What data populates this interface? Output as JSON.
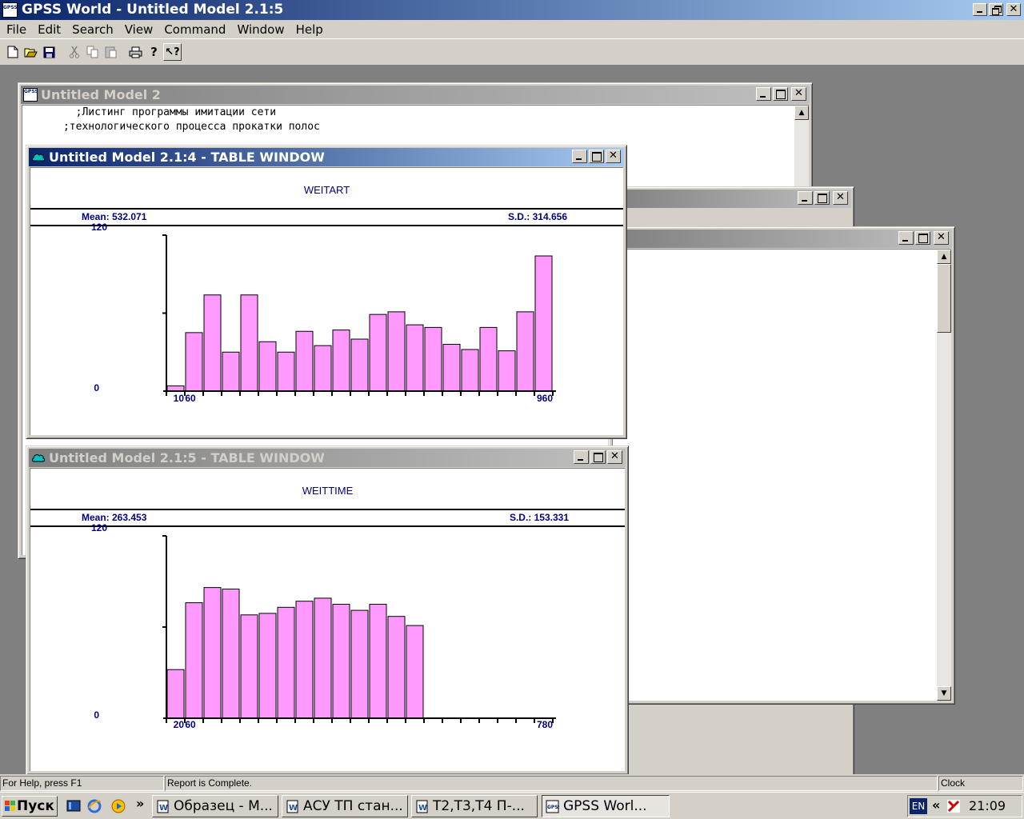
{
  "app": {
    "title": "GPSS World - Untitled Model 2.1:5",
    "icon_text": "GPSS"
  },
  "menu": [
    "File",
    "Edit",
    "Search",
    "View",
    "Command",
    "Window",
    "Help"
  ],
  "toolbar": {
    "buttons": [
      "new-icon",
      "open-icon",
      "save-icon",
      "cut-icon",
      "copy-icon",
      "paste-icon",
      "print-icon",
      "help-icon",
      "context-help-icon"
    ]
  },
  "model_window": {
    "title": "Untitled Model 2",
    "lines": [
      "        ;Листинг программы имитации сети",
      "      ;технологического процесса прокатки полос"
    ]
  },
  "table1": {
    "title": "Untitled Model 2.1:4  -  TABLE WINDOW",
    "name": "WEITART",
    "mean": "Mean: 532.071",
    "sd": "S.D.: 314.656"
  },
  "table2": {
    "title": "Untitled Model 2.1:5  -  TABLE WINDOW",
    "name": "WEITTIME",
    "mean": "Mean: 263.453",
    "sd": "S.D.: 153.331"
  },
  "chart_data": [
    {
      "type": "bar",
      "name": "WEITART",
      "ylim": [
        0,
        120
      ],
      "y_tick_labels": [
        "120",
        "0"
      ],
      "x_tick_labels": [
        "10",
        "60",
        "960"
      ],
      "bar_color": "#ff99ff",
      "num_slots": 21,
      "values": [
        4,
        45,
        74,
        30,
        74,
        38,
        30,
        46,
        35,
        47,
        40,
        59,
        61,
        51,
        49,
        36,
        32,
        49,
        31,
        61,
        104
      ]
    },
    {
      "type": "bar",
      "name": "WEITTIME",
      "ylim": [
        0,
        120
      ],
      "y_tick_labels": [
        "120",
        "0"
      ],
      "x_tick_labels": [
        "20",
        "60",
        "780"
      ],
      "bar_color": "#ff99ff",
      "num_slots": 21,
      "values": [
        32,
        76,
        86,
        85,
        68,
        69,
        73,
        77,
        79,
        75,
        71,
        75,
        67,
        61,
        0,
        0,
        0,
        0,
        0,
        0,
        0
      ]
    }
  ],
  "statusbar": {
    "help": "For Help, press F1",
    "message": "Report is Complete.",
    "clock_label": "Clock"
  },
  "taskbar": {
    "start": "Пуск",
    "tasks": [
      "Образец - М...",
      "АСУ ТП стан...",
      "Т2,Т3,Т4 П-...",
      "GPSS Worl..."
    ],
    "lang": "EN",
    "time": "21:09"
  },
  "colors": {
    "active_title": "#0a246a",
    "inactive_title": "#808080",
    "face": "#d4d0c8",
    "desktop": "#808080",
    "chart_text": "#000080",
    "bar_fill": "#ff99ff"
  }
}
